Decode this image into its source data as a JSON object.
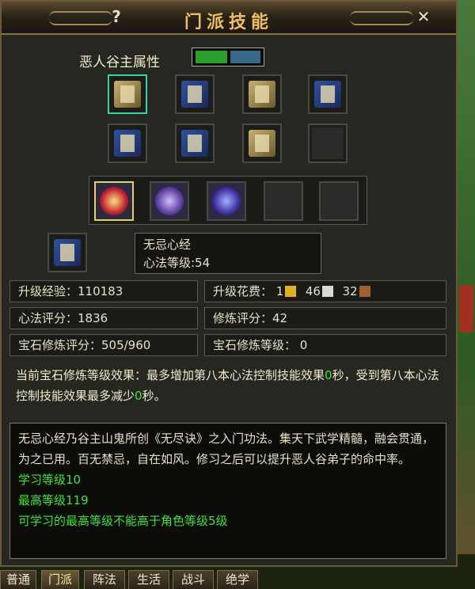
{
  "window": {
    "title": "门派技能",
    "help_glyph": "?",
    "close_glyph": "✕"
  },
  "attribute": {
    "label": "恶人谷主属性"
  },
  "selected": {
    "name": "无忌心经",
    "level_label": "心法等级:54"
  },
  "stats": {
    "exp_label": "升级经验：110183",
    "cost_label": "升级花费：",
    "cost_gold": "1",
    "cost_silver": "46",
    "cost_copper": "32",
    "xinfa_score": "心法评分：1836",
    "xiulian_score": "修炼评分：42",
    "gem_score": "宝石修炼评分：505/960",
    "gem_level": "宝石修炼等级： 0"
  },
  "effect": {
    "prefix": "当前宝石修炼等级效果：最多增加第八本心法控制技能效果",
    "v1": "0",
    "mid": "秒，受到第八本心法控制技能效果最多减少",
    "v2": "0",
    "suffix": "秒。"
  },
  "description": {
    "text": "无忌心经乃谷主山鬼所创《无尽诀》之入门功法。集天下武学精髓，融会贯通，为之已用。百无禁忌，自在如风。修习之后可以提升恶人谷弟子的命中率。",
    "learn_level": "学习等级10",
    "max_level": "最高等级119",
    "limit_note": "可学习的最高等级不能高于角色等级5级"
  },
  "tabs": [
    "普通",
    "门派",
    "阵法",
    "生活",
    "战斗",
    "绝学"
  ],
  "colors": {
    "title": "#f0c060",
    "highlight": "#40e040",
    "panel_bg": "#272721",
    "border": "#6b5a3a"
  },
  "icons": {
    "xinfa_slots": [
      "book-icon",
      "book-icon",
      "book-icon",
      "book-icon",
      "book-icon",
      "book-icon",
      "scroll-icon",
      "empty-slot"
    ],
    "skill_slots": [
      "slash-skill-icon",
      "summon-skill-icon",
      "scorpion-skill-icon",
      "empty-slot",
      "empty-slot"
    ]
  }
}
